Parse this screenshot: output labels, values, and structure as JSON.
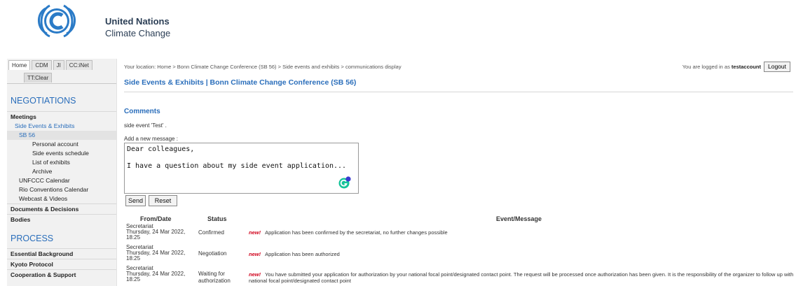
{
  "header": {
    "org_line1": "United Nations",
    "org_line2": "Climate Change"
  },
  "sidebar": {
    "tabs": [
      "Home",
      "CDM",
      "JI",
      "CC:iNet"
    ],
    "subtab": "TT:Clear",
    "section1": "NEGOTIATIONS",
    "meetings_group": "Meetings",
    "side_events": "Side Events & Exhibits",
    "sb56": "SB 56",
    "sb56_items": [
      "Personal account",
      "Side events schedule",
      "List of exhibits",
      "Archive"
    ],
    "meetings_items": [
      "UNFCCC Calendar",
      "Rio Conventions Calendar",
      "Webcast & Videos"
    ],
    "groups": [
      "Documents & Decisions",
      "Bodies"
    ],
    "section2": "PROCESS",
    "process_groups": [
      "Essential Background",
      "Kyoto Protocol",
      "Cooperation & Support"
    ]
  },
  "main": {
    "breadcrumb": "Your location: Home  >  Bonn Climate Change Conference (SB 56)  >  Side events and exhibits  >  communications display",
    "login_prefix": "You are logged in as ",
    "username": "testaccount",
    "logout_label": "Logout",
    "page_title": "Side Events & Exhibits | Bonn Climate Change Conference (SB 56)",
    "comments_heading": "Comments",
    "event_line": "side event 'Test' .",
    "add_label": "Add a new message :",
    "message_value": "Dear colleagues,\n\nI have a question about my side event application...",
    "send_label": "Send",
    "reset_label": "Reset"
  },
  "table": {
    "headers": [
      "From/Date",
      "Status",
      "Event/Message"
    ],
    "new_label": "new!",
    "rows": [
      {
        "from": "Secretariat",
        "date": "Thursday, 24 Mar 2022,",
        "time": "18:25",
        "status": "Confirmed",
        "message": "Application has been confirmed by the secretariat, no further changes possible"
      },
      {
        "from": "Secretariat",
        "date": "Thursday, 24 Mar 2022,",
        "time": "18:25",
        "status": "Negotiation",
        "message": "Application has been authorized"
      },
      {
        "from": "Secretariat",
        "date": "Thursday, 24 Mar 2022,",
        "time": "18:25",
        "status": "Waiting for authorization",
        "message": "You have submitted your application for authorization by your national focal point/designated contact point. The request will be processed once authorization has been given. It is the responsibility of the organizer to follow up with national focal point/designated contact point"
      }
    ]
  },
  "colors": {
    "link_blue": "#2a6ebb",
    "new_red": "#d0021b",
    "brand_navy": "#2b3e55"
  },
  "icons": [
    "unfccc-logo",
    "grammarly-icon"
  ]
}
